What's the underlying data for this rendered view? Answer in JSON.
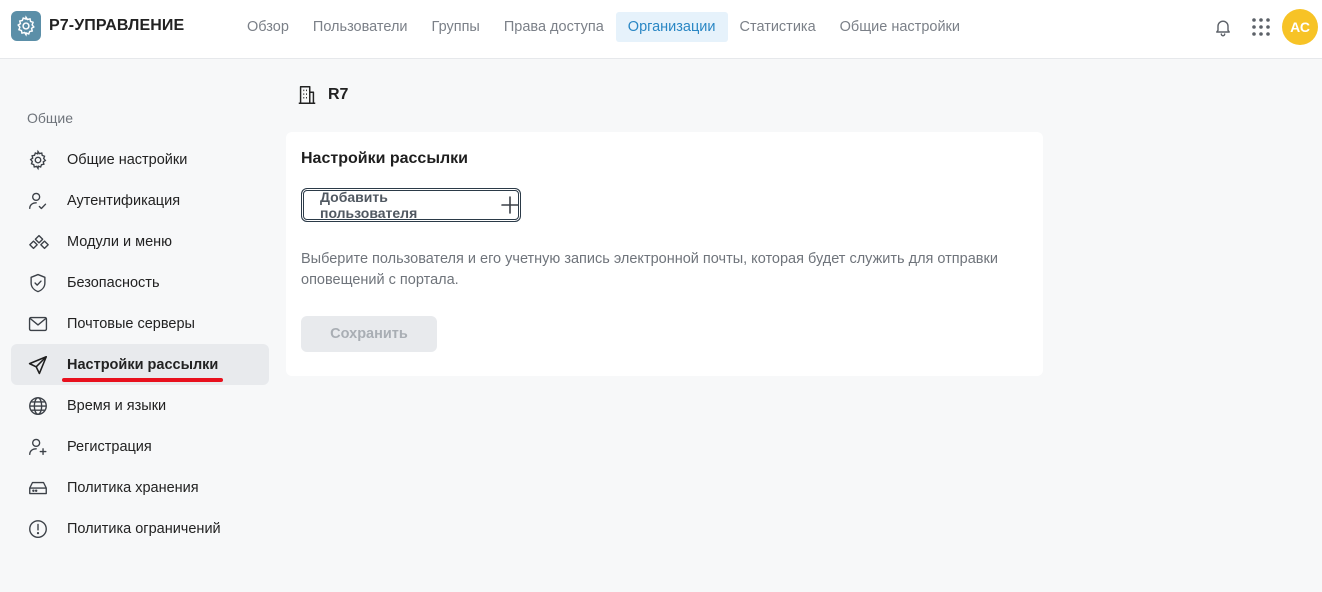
{
  "app": {
    "name": "Р7-УПРАВЛЕНИЕ"
  },
  "nav": {
    "items": [
      {
        "label": "Обзор"
      },
      {
        "label": "Пользователи"
      },
      {
        "label": "Группы"
      },
      {
        "label": "Права доступа"
      },
      {
        "label": "Организации",
        "active": true
      },
      {
        "label": "Статистика"
      },
      {
        "label": "Общие настройки"
      }
    ]
  },
  "user": {
    "initials": "АС"
  },
  "sidebar": {
    "section": "Общие",
    "items": [
      {
        "label": "Общие настройки",
        "icon": "gear-icon"
      },
      {
        "label": "Аутентификация",
        "icon": "user-check-icon"
      },
      {
        "label": "Модули и меню",
        "icon": "modules-icon"
      },
      {
        "label": "Безопасность",
        "icon": "shield-icon"
      },
      {
        "label": "Почтовые серверы",
        "icon": "mail-icon"
      },
      {
        "label": "Настройки рассылки",
        "icon": "send-icon",
        "active": true
      },
      {
        "label": "Время и языки",
        "icon": "globe-icon"
      },
      {
        "label": "Регистрация",
        "icon": "user-plus-icon"
      },
      {
        "label": "Политика хранения",
        "icon": "storage-icon"
      },
      {
        "label": "Политика ограничений",
        "icon": "alert-circle-icon"
      }
    ]
  },
  "main": {
    "org_name": "R7",
    "card": {
      "title": "Настройки рассылки",
      "add_user_label": "Добавить пользователя",
      "description": "Выберите пользователя и его учетную запись электронной почты, которая будет служить для отправки оповещений с портала.",
      "save_label": "Сохранить"
    }
  },
  "colors": {
    "accent": "#2a87c4",
    "active_tab_bg": "#e6f2fb",
    "avatar": "#f7c326",
    "highlight_underline": "#e8101d"
  }
}
